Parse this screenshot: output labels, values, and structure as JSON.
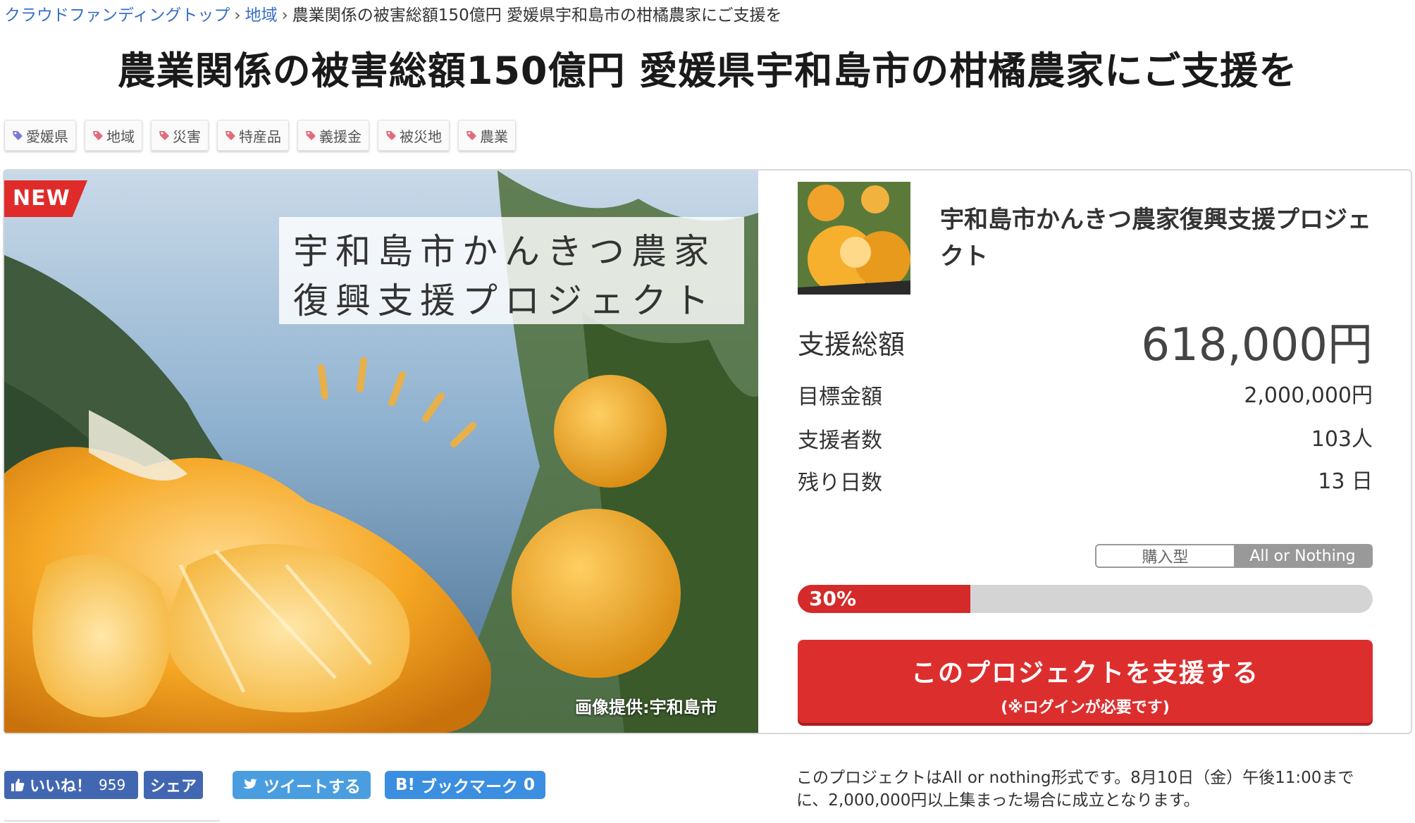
{
  "breadcrumb": {
    "items": [
      "クラウドファンディングトップ",
      "地域",
      "農業関係の被害総額150億円 愛媛県宇和島市の柑橘農家にご支援を"
    ],
    "separator": "›"
  },
  "page_title": "農業関係の被害総額150億円 愛媛県宇和島市の柑橘農家にご支援を",
  "tags": [
    "愛媛県",
    "地域",
    "災害",
    "特産品",
    "義援金",
    "被災地",
    "農業"
  ],
  "hero": {
    "badge": "NEW",
    "caption_line1": "宇和島市かんきつ農家",
    "caption_line2": "復興支援プロジェクト",
    "credit": "画像提供:宇和島市"
  },
  "project": {
    "name": "宇和島市かんきつ農家復興支援プロジェクト",
    "total_label": "支援総額",
    "total_value": "618,000円",
    "goal_label": "目標金額",
    "goal_value": "2,000,000円",
    "supporters_label": "支援者数",
    "supporters_value": "103人",
    "days_label": "残り日数",
    "days_value": "13 日",
    "type_options": [
      "購入型",
      "All or Nothing"
    ],
    "type_selected": "All or Nothing",
    "progress_percent": 30,
    "progress_label": "30%",
    "support_button_line1": "このプロジェクトを支援する",
    "support_button_line2": "(※ログインが必要です)"
  },
  "social": {
    "like_label": "いいね！",
    "like_count": "959",
    "share_label": "シェア",
    "tweet_label": "ツイートする",
    "hatena_label": "ブックマーク",
    "hatena_prefix": "B!",
    "hatena_count": "0"
  },
  "note": "このプロジェクトはAll or nothing形式です。8月10日（金）午後11:00までに、2,000,000円以上集まった場合に成立となります。",
  "colors": {
    "accent_red": "#dd2e2e",
    "link_blue": "#3a6fc4",
    "facebook": "#4267b2",
    "twitter": "#4a9ee0",
    "hatena": "#3b8ee0"
  }
}
